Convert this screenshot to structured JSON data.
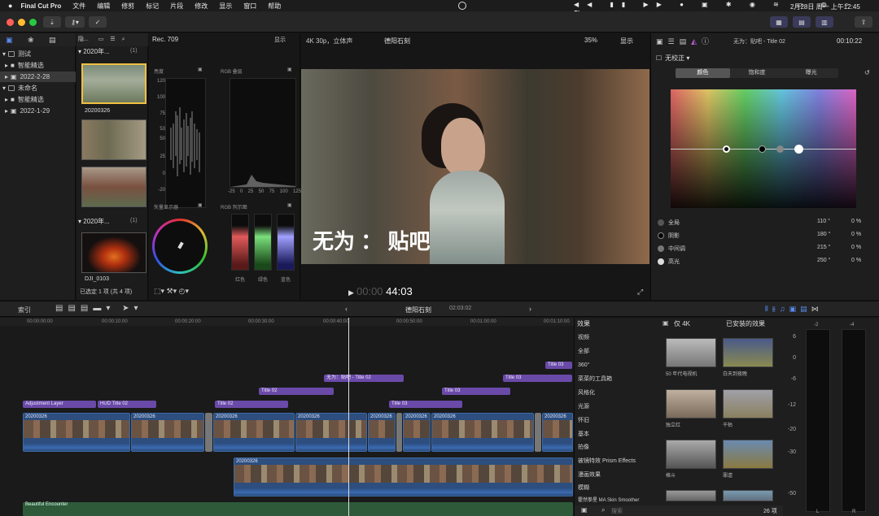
{
  "menubar": {
    "app": "Final Cut Pro",
    "items": [
      "文件",
      "编辑",
      "修剪",
      "标记",
      "片段",
      "修改",
      "显示",
      "窗口",
      "帮助"
    ],
    "datetime": "2月28日 周一 上午12:45"
  },
  "library": {
    "items": [
      {
        "label": "测试",
        "type": "library"
      },
      {
        "label": "智能精选",
        "type": "folder"
      },
      {
        "label": "2022-2-28",
        "type": "event"
      },
      {
        "label": "未命名",
        "type": "library"
      },
      {
        "label": "智能精选",
        "type": "folder"
      },
      {
        "label": "2022-1-29",
        "type": "event"
      }
    ],
    "header": "隐..."
  },
  "browser": {
    "group1": "2020年...",
    "group1_count": "(1)",
    "group2": "2020年...",
    "group2_count": "(1)",
    "clip1": "20200326",
    "clip2": "DJI_0103",
    "status": "已选定 1 项 (共 4 项)"
  },
  "scopes": {
    "rec": "Rec. 709",
    "display": "显示",
    "waveform_title": "亮度",
    "waveform_axis": [
      "120",
      "100",
      "75",
      "53",
      "50",
      "25",
      "0",
      "-20"
    ],
    "rgb_title": "RGB 叠层",
    "rgb_axis": [
      "-25",
      "0",
      "25",
      "50",
      "75",
      "100",
      "125"
    ],
    "vector_title": "矢量显示器",
    "rgbparade_title": "RGB 列示图",
    "parade_labels": [
      "红色",
      "绿色",
      "蓝色"
    ]
  },
  "viewer": {
    "format": "4K 30p，立体声",
    "title": "德阳石刻",
    "zoom": "35%",
    "display": "显示",
    "subtitle": "无为 ： 贴吧",
    "timecode_dim": "00:00",
    "timecode": "44:03"
  },
  "inspector": {
    "title": "无为：贴吧 - Title 02",
    "time": "00:10:22",
    "correction": "无校正",
    "tabs": [
      "颜色",
      "饱和度",
      "曝光"
    ],
    "rows": [
      {
        "label": "全局",
        "deg": "110 °",
        "pct": "0 %"
      },
      {
        "label": "阴影",
        "deg": "180 °",
        "pct": "0 %"
      },
      {
        "label": "中间调",
        "deg": "215 °",
        "pct": "0 %"
      },
      {
        "label": "高光",
        "deg": "250 °",
        "pct": "0 %"
      }
    ]
  },
  "timeline": {
    "index": "索引",
    "project": "德阳石刻",
    "duration": "02:03:02",
    "ruler": [
      "00:00:00:00",
      "00:00:10:00",
      "00:00:20:00",
      "00:00:30:00",
      "00:00:40:00",
      "00:00:50:00",
      "00:01:00:00",
      "00:01:10:00"
    ],
    "titles": [
      {
        "t": "Title 03"
      },
      {
        "t": "无为：贴吧 - Title 02"
      },
      {
        "t": "Title 03"
      },
      {
        "t": "Title 02"
      },
      {
        "t": "Title 03"
      },
      {
        "t": "Adjustment Layer"
      },
      {
        "t": "HUD Title 02"
      },
      {
        "t": "Title 02"
      },
      {
        "t": "Title 03"
      }
    ],
    "primary_clips": [
      "20200326",
      "20200326",
      "20200326",
      "20200326",
      "20200326",
      "20200326",
      "20200326",
      "20200326",
      "20200326"
    ],
    "connected_clip": "20200326",
    "audio": "Beautiful Encounter"
  },
  "effects": {
    "header": "效果",
    "filter": "仅 4K",
    "installed": "已安装的效果",
    "categories": [
      "视频",
      "全部",
      "360°",
      "菜菜的工具箱",
      "风格化",
      "光源",
      "怀旧",
      "基本",
      "拍像",
      "被镜特效 Prism Effects",
      "漫画效果",
      "模糊",
      "霍然拳星 MA Skin Smoother"
    ],
    "thumbs": [
      "50 年代电视机",
      "白天到夜晚",
      "独立红",
      "干枯",
      "格斗",
      "罪虐"
    ],
    "search": "搜索",
    "count": "26 项"
  },
  "meters": {
    "labels": [
      "-2",
      "-4",
      "6",
      "0",
      "-6",
      "-12",
      "-20",
      "-30",
      "-50"
    ],
    "channels": [
      "L",
      "R"
    ]
  }
}
